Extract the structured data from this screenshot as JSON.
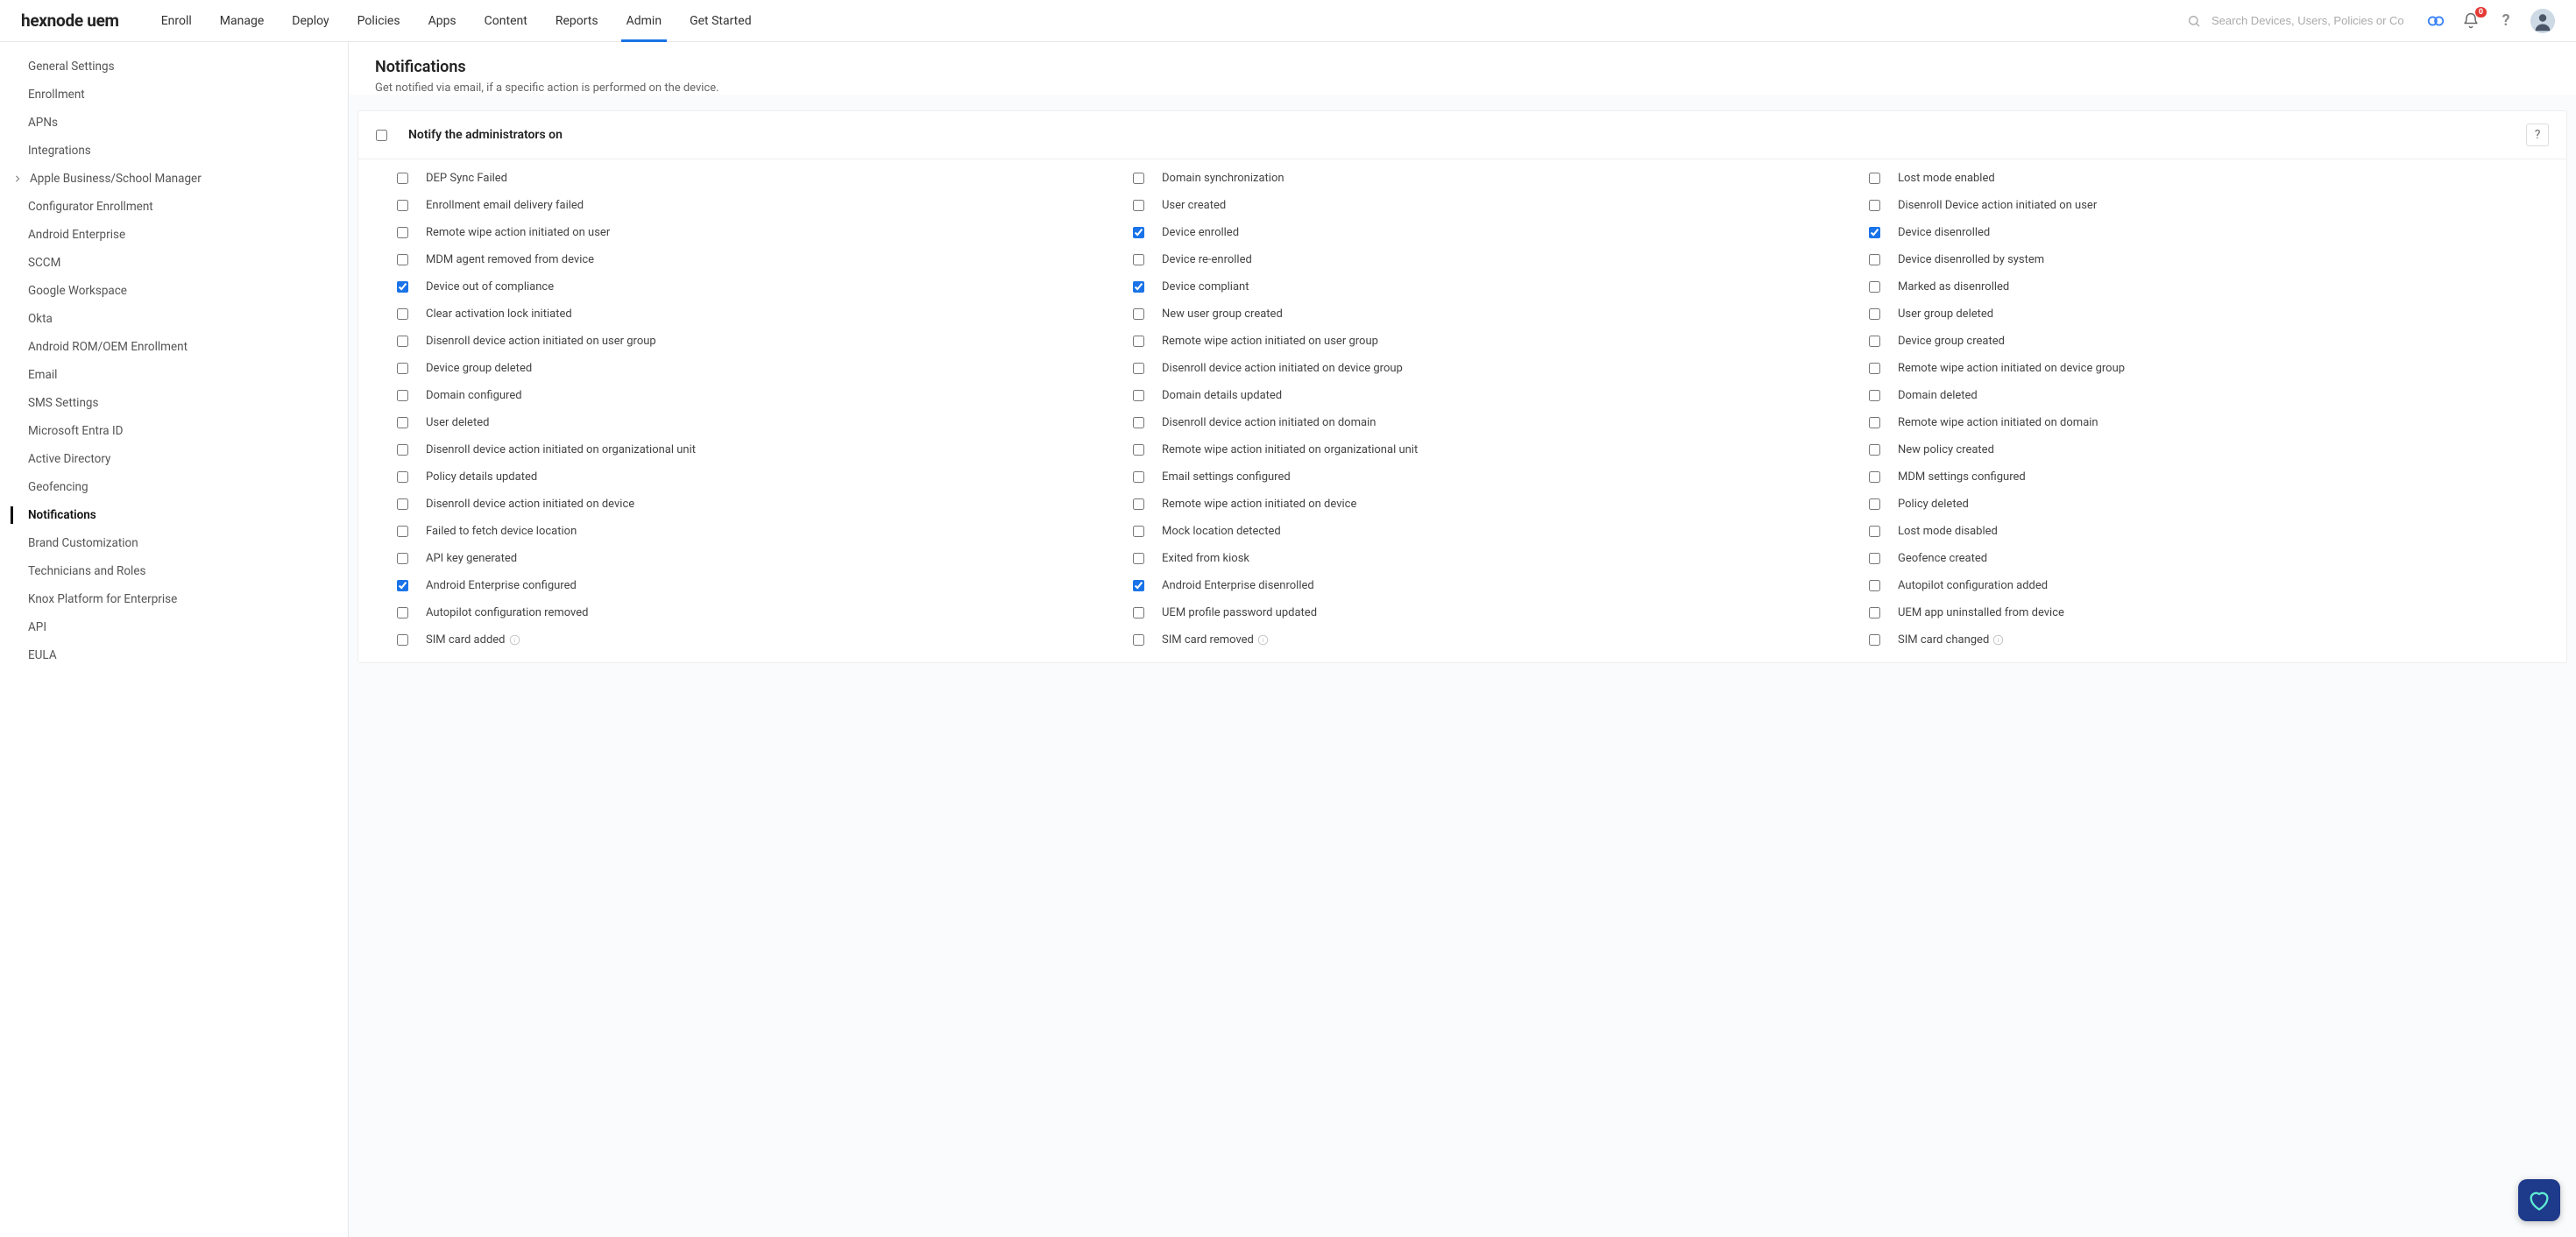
{
  "logo": "hexnode uem",
  "nav": [
    {
      "label": "Enroll",
      "active": false
    },
    {
      "label": "Manage",
      "active": false
    },
    {
      "label": "Deploy",
      "active": false
    },
    {
      "label": "Policies",
      "active": false
    },
    {
      "label": "Apps",
      "active": false
    },
    {
      "label": "Content",
      "active": false
    },
    {
      "label": "Reports",
      "active": false
    },
    {
      "label": "Admin",
      "active": true
    },
    {
      "label": "Get Started",
      "active": false
    }
  ],
  "search_placeholder": "Search Devices, Users, Policies or Content",
  "bell_count": "0",
  "sidebar": [
    {
      "label": "General Settings",
      "active": false,
      "expandable": false
    },
    {
      "label": "Enrollment",
      "active": false,
      "expandable": false
    },
    {
      "label": "APNs",
      "active": false,
      "expandable": false
    },
    {
      "label": "Integrations",
      "active": false,
      "expandable": false
    },
    {
      "label": "Apple Business/School Manager",
      "active": false,
      "expandable": true
    },
    {
      "label": "Configurator Enrollment",
      "active": false,
      "expandable": false
    },
    {
      "label": "Android Enterprise",
      "active": false,
      "expandable": false
    },
    {
      "label": "SCCM",
      "active": false,
      "expandable": false
    },
    {
      "label": "Google Workspace",
      "active": false,
      "expandable": false
    },
    {
      "label": "Okta",
      "active": false,
      "expandable": false
    },
    {
      "label": "Android ROM/OEM Enrollment",
      "active": false,
      "expandable": false
    },
    {
      "label": "Email",
      "active": false,
      "expandable": false
    },
    {
      "label": "SMS Settings",
      "active": false,
      "expandable": false
    },
    {
      "label": "Microsoft Entra ID",
      "active": false,
      "expandable": false
    },
    {
      "label": "Active Directory",
      "active": false,
      "expandable": false
    },
    {
      "label": "Geofencing",
      "active": false,
      "expandable": false
    },
    {
      "label": "Notifications",
      "active": true,
      "expandable": false
    },
    {
      "label": "Brand Customization",
      "active": false,
      "expandable": false
    },
    {
      "label": "Technicians and Roles",
      "active": false,
      "expandable": false
    },
    {
      "label": "Knox Platform for Enterprise",
      "active": false,
      "expandable": false
    },
    {
      "label": "API",
      "active": false,
      "expandable": false
    },
    {
      "label": "EULA",
      "active": false,
      "expandable": false
    }
  ],
  "page": {
    "title": "Notifications",
    "subtitle": "Get notified via email, if a specific action is performed on the device.",
    "section_title": "Notify the administrators on",
    "section_checked": false
  },
  "items": [
    {
      "label": "DEP Sync Failed",
      "checked": false,
      "info": false
    },
    {
      "label": "Domain synchronization",
      "checked": false,
      "info": false
    },
    {
      "label": "Lost mode enabled",
      "checked": false,
      "info": false
    },
    {
      "label": "Enrollment email delivery failed",
      "checked": false,
      "info": false
    },
    {
      "label": "User created",
      "checked": false,
      "info": false
    },
    {
      "label": "Disenroll Device action initiated on user",
      "checked": false,
      "info": false
    },
    {
      "label": "Remote wipe action initiated on user",
      "checked": false,
      "info": false
    },
    {
      "label": "Device enrolled",
      "checked": true,
      "info": false
    },
    {
      "label": "Device disenrolled",
      "checked": true,
      "info": false
    },
    {
      "label": "MDM agent removed from device",
      "checked": false,
      "info": false
    },
    {
      "label": "Device re-enrolled",
      "checked": false,
      "info": false
    },
    {
      "label": "Device disenrolled by system",
      "checked": false,
      "info": false
    },
    {
      "label": "Device out of compliance",
      "checked": true,
      "info": false
    },
    {
      "label": "Device compliant",
      "checked": true,
      "info": false
    },
    {
      "label": "Marked as disenrolled",
      "checked": false,
      "info": false
    },
    {
      "label": "Clear activation lock initiated",
      "checked": false,
      "info": false
    },
    {
      "label": "New user group created",
      "checked": false,
      "info": false
    },
    {
      "label": "User group deleted",
      "checked": false,
      "info": false
    },
    {
      "label": "Disenroll device action initiated on user group",
      "checked": false,
      "info": false
    },
    {
      "label": "Remote wipe action initiated on user group",
      "checked": false,
      "info": false
    },
    {
      "label": "Device group created",
      "checked": false,
      "info": false
    },
    {
      "label": "Device group deleted",
      "checked": false,
      "info": false
    },
    {
      "label": "Disenroll device action initiated on device group",
      "checked": false,
      "info": false
    },
    {
      "label": "Remote wipe action initiated on device group",
      "checked": false,
      "info": false
    },
    {
      "label": "Domain configured",
      "checked": false,
      "info": false
    },
    {
      "label": "Domain details updated",
      "checked": false,
      "info": false
    },
    {
      "label": "Domain deleted",
      "checked": false,
      "info": false
    },
    {
      "label": "User deleted",
      "checked": false,
      "info": false
    },
    {
      "label": "Disenroll device action initiated on domain",
      "checked": false,
      "info": false
    },
    {
      "label": "Remote wipe action initiated on domain",
      "checked": false,
      "info": false
    },
    {
      "label": "Disenroll device action initiated on organizational unit",
      "checked": false,
      "info": false
    },
    {
      "label": "Remote wipe action initiated on organizational unit",
      "checked": false,
      "info": false
    },
    {
      "label": "New policy created",
      "checked": false,
      "info": false
    },
    {
      "label": "Policy details updated",
      "checked": false,
      "info": false
    },
    {
      "label": "Email settings configured",
      "checked": false,
      "info": false
    },
    {
      "label": "MDM settings configured",
      "checked": false,
      "info": false
    },
    {
      "label": "Disenroll device action initiated on device",
      "checked": false,
      "info": false
    },
    {
      "label": "Remote wipe action initiated on device",
      "checked": false,
      "info": false
    },
    {
      "label": "Policy deleted",
      "checked": false,
      "info": false
    },
    {
      "label": "Failed to fetch device location",
      "checked": false,
      "info": false
    },
    {
      "label": "Mock location detected",
      "checked": false,
      "info": false
    },
    {
      "label": "Lost mode disabled",
      "checked": false,
      "info": false
    },
    {
      "label": "API key generated",
      "checked": false,
      "info": false
    },
    {
      "label": "Exited from kiosk",
      "checked": false,
      "info": false
    },
    {
      "label": "Geofence created",
      "checked": false,
      "info": false
    },
    {
      "label": "Android Enterprise configured",
      "checked": true,
      "info": false
    },
    {
      "label": "Android Enterprise disenrolled",
      "checked": true,
      "info": false
    },
    {
      "label": "Autopilot configuration added",
      "checked": false,
      "info": false
    },
    {
      "label": "Autopilot configuration removed",
      "checked": false,
      "info": false
    },
    {
      "label": "UEM profile password updated",
      "checked": false,
      "info": false
    },
    {
      "label": "UEM app uninstalled from device",
      "checked": false,
      "info": false
    },
    {
      "label": "SIM card added",
      "checked": false,
      "info": true
    },
    {
      "label": "SIM card removed",
      "checked": false,
      "info": true
    },
    {
      "label": "SIM card changed",
      "checked": false,
      "info": true
    }
  ]
}
